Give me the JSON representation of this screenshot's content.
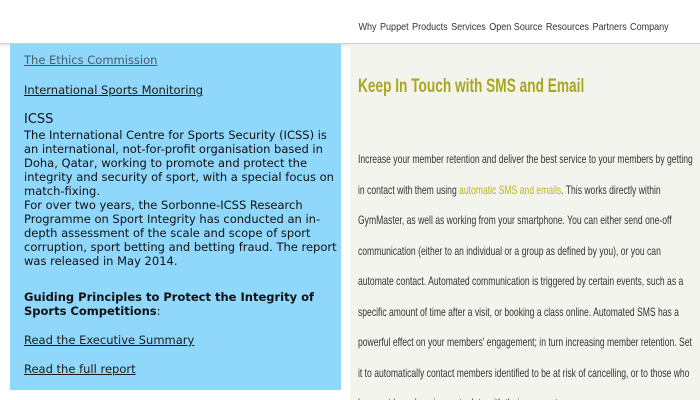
{
  "topnav": {
    "items": [
      "Why",
      "Puppet",
      "Products",
      "Services",
      "Open Source",
      "Resources",
      "Partners",
      "Company"
    ]
  },
  "left_panel": {
    "ethics_link": "The Ethics Commission",
    "monitoring_link": "International Sports Monitoring",
    "icss_title": "ICSS",
    "icss_para1": "The International Centre for Sports Security (ICSS) is an international, not-for-profit organisation based in Doha, Qatar, working to promote and protect the integrity and security of sport, with a special focus on match-fixing.",
    "icss_para2": "For over two years, the Sorbonne-ICSS Research Programme on Sport Integrity has conducted an in-depth assessment of the scale and scope of sport corruption, sport betting and betting fraud. The report was released in May 2014.",
    "principles_heading": "Guiding Principles to Protect the Integrity of Sports Competitions",
    "principles_colon": ":",
    "exec_summary_link": "Read the Executive Summary",
    "full_report_link": "Read the full report"
  },
  "right_card": {
    "title": "Keep In Touch with SMS and Email",
    "body_before": "Increase your member retention and deliver the best service to your members by getting in contact with them using ",
    "body_highlight": "automatic SMS and emails",
    "body_after": ". This works directly within GymMaster, as well as working from your smartphone. You can either send one-off communication (either to an individual or a group as defined by you), or you can automate contact. Automated communication is triggered by certain events, such as a specific amount of time after a visit, or booking a class online. Automated SMS has a powerful effect on your members' engagement; in turn increasing member retention. Set it to automatically contact members identified to be at risk of cancelling, or to those who have not been keeping up to date with their payments.",
    "title_color": "#a8a820",
    "highlight_color": "#b8b818"
  },
  "colors": {
    "left_panel_bg": "#8fd7fb",
    "right_card_bg": "#f4f4ef"
  }
}
